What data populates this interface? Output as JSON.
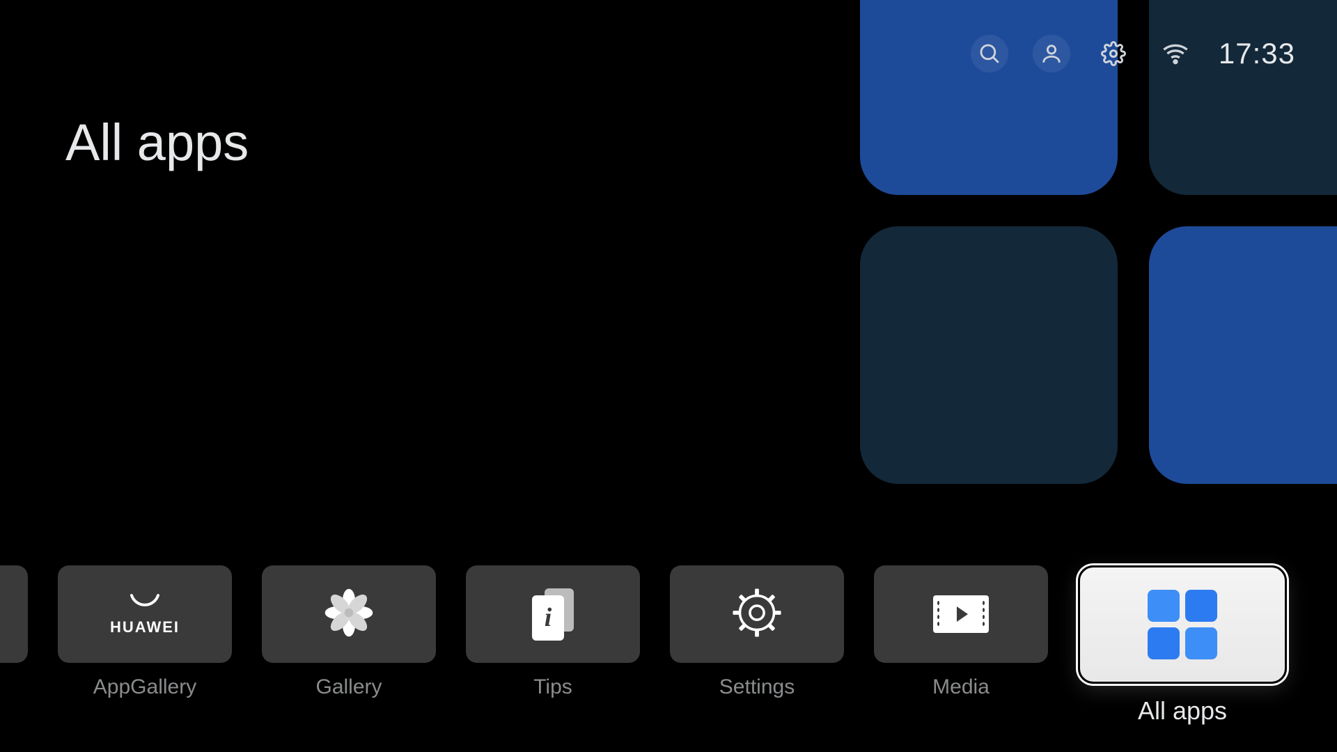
{
  "status": {
    "time": "17:33"
  },
  "title": "All apps",
  "dock": {
    "items": [
      {
        "label": ""
      },
      {
        "label": "AppGallery",
        "brand": "HUAWEI"
      },
      {
        "label": "Gallery"
      },
      {
        "label": "Tips",
        "glyph": "i"
      },
      {
        "label": "Settings"
      },
      {
        "label": "Media"
      },
      {
        "label": "All apps"
      }
    ]
  }
}
